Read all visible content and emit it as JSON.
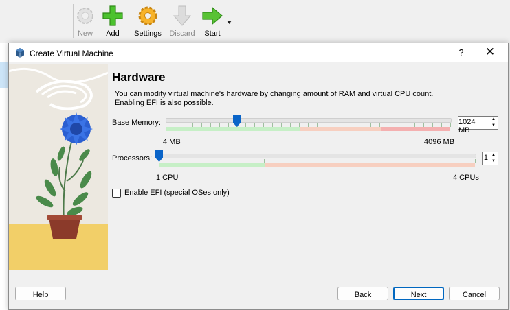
{
  "toolbar": {
    "new_label": "New",
    "add_label": "Add",
    "settings_label": "Settings",
    "discard_label": "Discard",
    "start_label": "Start"
  },
  "dialog": {
    "title": "Create Virtual Machine",
    "help_glyph": "?",
    "close_glyph": "✕"
  },
  "hardware": {
    "heading": "Hardware",
    "description_line1": "You can modify virtual machine's hardware by changing amount of RAM and virtual CPU count.",
    "description_line2": "Enabling EFI is also possible.",
    "memory": {
      "label": "Base Memory:",
      "value": "1024 MB",
      "min_label": "4 MB",
      "max_label": "4096 MB",
      "min_mb": 4,
      "max_mb": 4096,
      "current_mb": 1024
    },
    "processors": {
      "label": "Processors:",
      "value": "1",
      "min_label": "1 CPU",
      "max_label": "4 CPUs",
      "min": 1,
      "max": 4,
      "current": 1
    },
    "efi": {
      "label": "Enable EFI (special OSes only)",
      "checked": false
    }
  },
  "buttons": {
    "help": "Help",
    "back": "Back",
    "next": "Next",
    "cancel": "Cancel"
  },
  "colors": {
    "zone_green": "#c6efc6",
    "zone_orange": "#f7cfc0",
    "zone_red": "#f4b0b0",
    "handle_blue": "#0a64c8",
    "default_button_border": "#0067c0",
    "selection_blue": "#cce4f7"
  }
}
